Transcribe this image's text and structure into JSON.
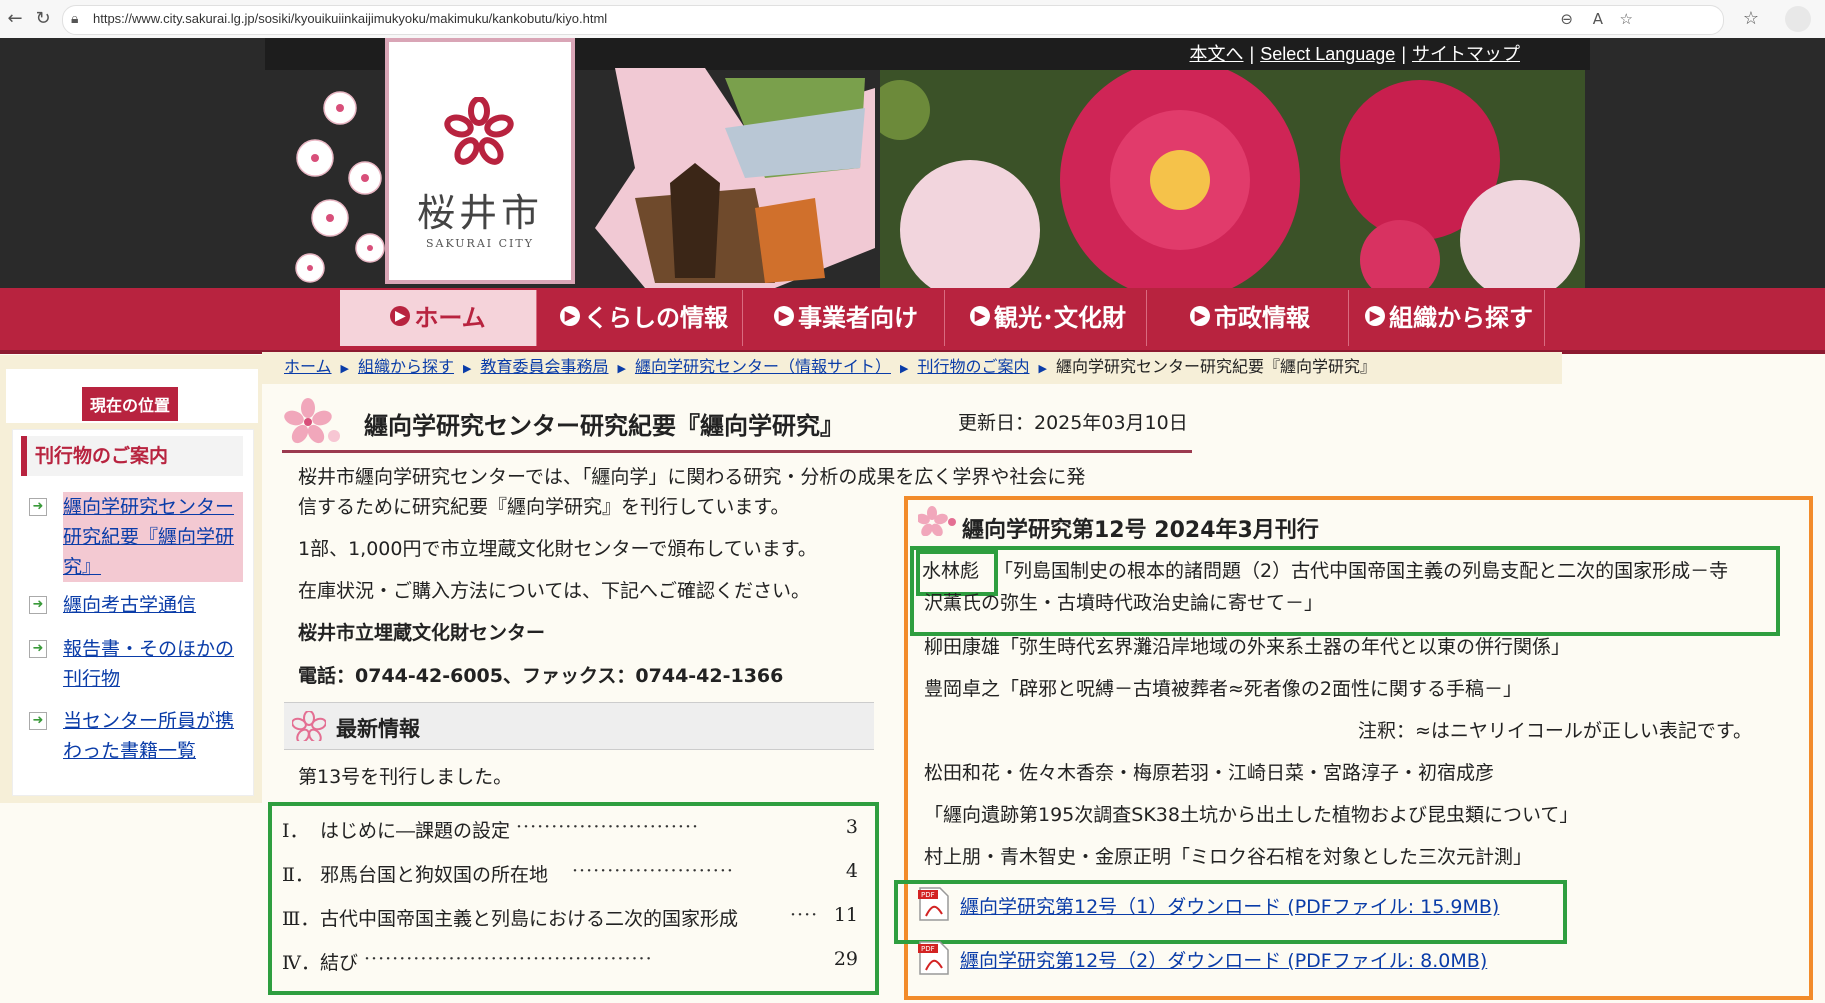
{
  "browser": {
    "url": "https://www.city.sakurai.lg.jp/sosiki/kyouikuiinkaijimukyoku/makimuku/kankobutu/kiyo.html"
  },
  "header": {
    "toplinks": [
      "本文へ",
      "Select Language",
      "サイトマップ"
    ],
    "logo_name": "桜井市",
    "logo_en": "SAKURAI CITY"
  },
  "nav": {
    "items": [
      "ホーム",
      "くらしの情報",
      "事業者向け",
      "観光･文化財",
      "市政情報",
      "組織から探す"
    ]
  },
  "sidebar": {
    "current_label": "現在の位置",
    "title": "刊行物のご案内",
    "items": [
      {
        "label": "纒向学研究センター研究紀要『纒向学研究』",
        "lines": [
          "纒向学研究センター",
          "研究紀要『纒向学研",
          "究』"
        ]
      },
      {
        "label": "纒向考古学通信",
        "lines": [
          "纒向考古学通信"
        ]
      },
      {
        "label": "報告書・そのほかの刊行物",
        "lines": [
          "報告書・そのほかの",
          "刊行物"
        ]
      },
      {
        "label": "当センター所員が携わった書籍一覧",
        "lines": [
          "当センター所員が携",
          "わった書籍一覧"
        ]
      }
    ]
  },
  "breadcrumb": {
    "links": [
      "ホーム",
      "組織から探す",
      "教育委員会事務局",
      "纒向学研究センター（情報サイト）",
      "刊行物のご案内"
    ],
    "current": "纒向学研究センター研究紀要『纒向学研究』"
  },
  "page": {
    "title": "纒向学研究センター研究紀要『纒向学研究』",
    "updated": "更新日：2025年03月10日",
    "intro_lines": [
      "桜井市纒向学研究センターでは、「纒向学」に関わる研究・分析の成果を広く学界や社会に発",
      "信するために研究紀要『纒向学研究』を刊行しています。",
      "1部、1,000円で市立埋蔵文化財センターで頒布しています。",
      "在庫状況・ご購入方法については、下記へご確認ください。"
    ],
    "contact_name": "桜井市立埋蔵文化財センター",
    "contact_phone": "電話：0744-42-6005、ファックス：0744-42-1366",
    "latest_heading": "最新情報",
    "latest_text": "第13号を刊行しました。"
  },
  "toc": [
    {
      "num": "Ⅰ．",
      "title": "はじめに―課題の設定",
      "page": "3"
    },
    {
      "num": "Ⅱ．",
      "title": "邪馬台国と狗奴国の所在地",
      "page": "4"
    },
    {
      "num": "Ⅲ．",
      "title": "古代中国帝国主義と列島における二次的国家形成",
      "page": "11"
    },
    {
      "num": "Ⅳ．",
      "title": "結び",
      "page": "29"
    }
  ],
  "issue12": {
    "heading": "纒向学研究第12号 2024年3月刊行",
    "articles": [
      {
        "author": "水林彪",
        "lines": [
          "「列島国制史の根本的諸問題（2）古代中国帝国主義の列島支配と二次的国家形成－寺",
          "沢薫氏の弥生・古墳時代政治史論に寄せて－」"
        ]
      },
      {
        "text": "柳田康雄「弥生時代玄界灘沿岸地域の外来系土器の年代と以東の併行関係」"
      },
      {
        "text": "豊岡卓之「辟邪と呪縛－古墳被葬者≈死者像の2面性に関する手稿－」"
      },
      {
        "note": "注釈：≈はニヤリイコールが正しい表記です。"
      },
      {
        "text": "松田和花・佐々木香奈・梅原若羽・江崎日菜・宮路淳子・初宿成彦"
      },
      {
        "text": "「纒向遺跡第195次調査SK38土坑から出土した植物および昆虫類について」"
      },
      {
        "text": "村上朋・青木智史・金原正明「ミロク谷石棺を対象とした三次元計測」"
      }
    ],
    "downloads": [
      "纒向学研究第12号（1）ダウンロード (PDFファイル: 15.9MB)",
      "纒向学研究第12号（2）ダウンロード (PDFファイル: 8.0MB)"
    ]
  },
  "colors": {
    "brand": "#b8233f",
    "highlight_green": "#2e9e3f",
    "highlight_orange": "#f28b2a",
    "link": "#0a3ca8"
  }
}
